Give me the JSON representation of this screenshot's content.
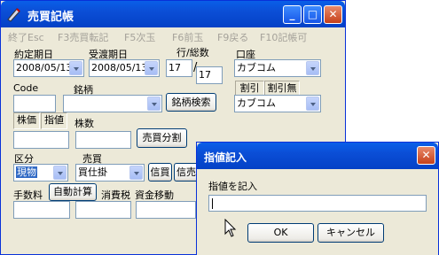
{
  "main_window": {
    "title": "売買記帳",
    "controls": {
      "minimize": "_",
      "maximize": "□",
      "close": "✕"
    },
    "menu": [
      "終了Esc",
      "F3売買転記",
      "F5次玉",
      "F6前玉",
      "F9戻る",
      "F10記帳可"
    ],
    "labels": {
      "contract_date": "約定期日",
      "delivery_date": "受渡期日",
      "row_total": "行/総数",
      "account": "口座",
      "code": "Code",
      "brand": "銘柄",
      "discount1": "割引",
      "discount2": "割引無",
      "stock_price": "株価",
      "limit": "指値",
      "quantity": "株数",
      "category": "区分",
      "trade": "売買",
      "commission": "手数料",
      "consumption_tax": "消費税",
      "fund_transfer": "資金移動"
    },
    "values": {
      "contract_date": "2008/05/13",
      "delivery_date": "2008/05/13",
      "row": "17",
      "total": "17",
      "account1": "カブコム",
      "account2": "カブコム",
      "category": "現物",
      "trade": "買仕掛",
      "code": "",
      "brand": ""
    },
    "buttons": {
      "brand_search": "銘柄検索",
      "split": "売買分割",
      "credit": "信買",
      "credit2": "信売",
      "auto_calc": "自動計算"
    }
  },
  "dialog": {
    "title": "指値記入",
    "prompt": "指値を記入",
    "input_value": "",
    "ok": "OK",
    "cancel": "キャンセル",
    "close": "✕"
  }
}
